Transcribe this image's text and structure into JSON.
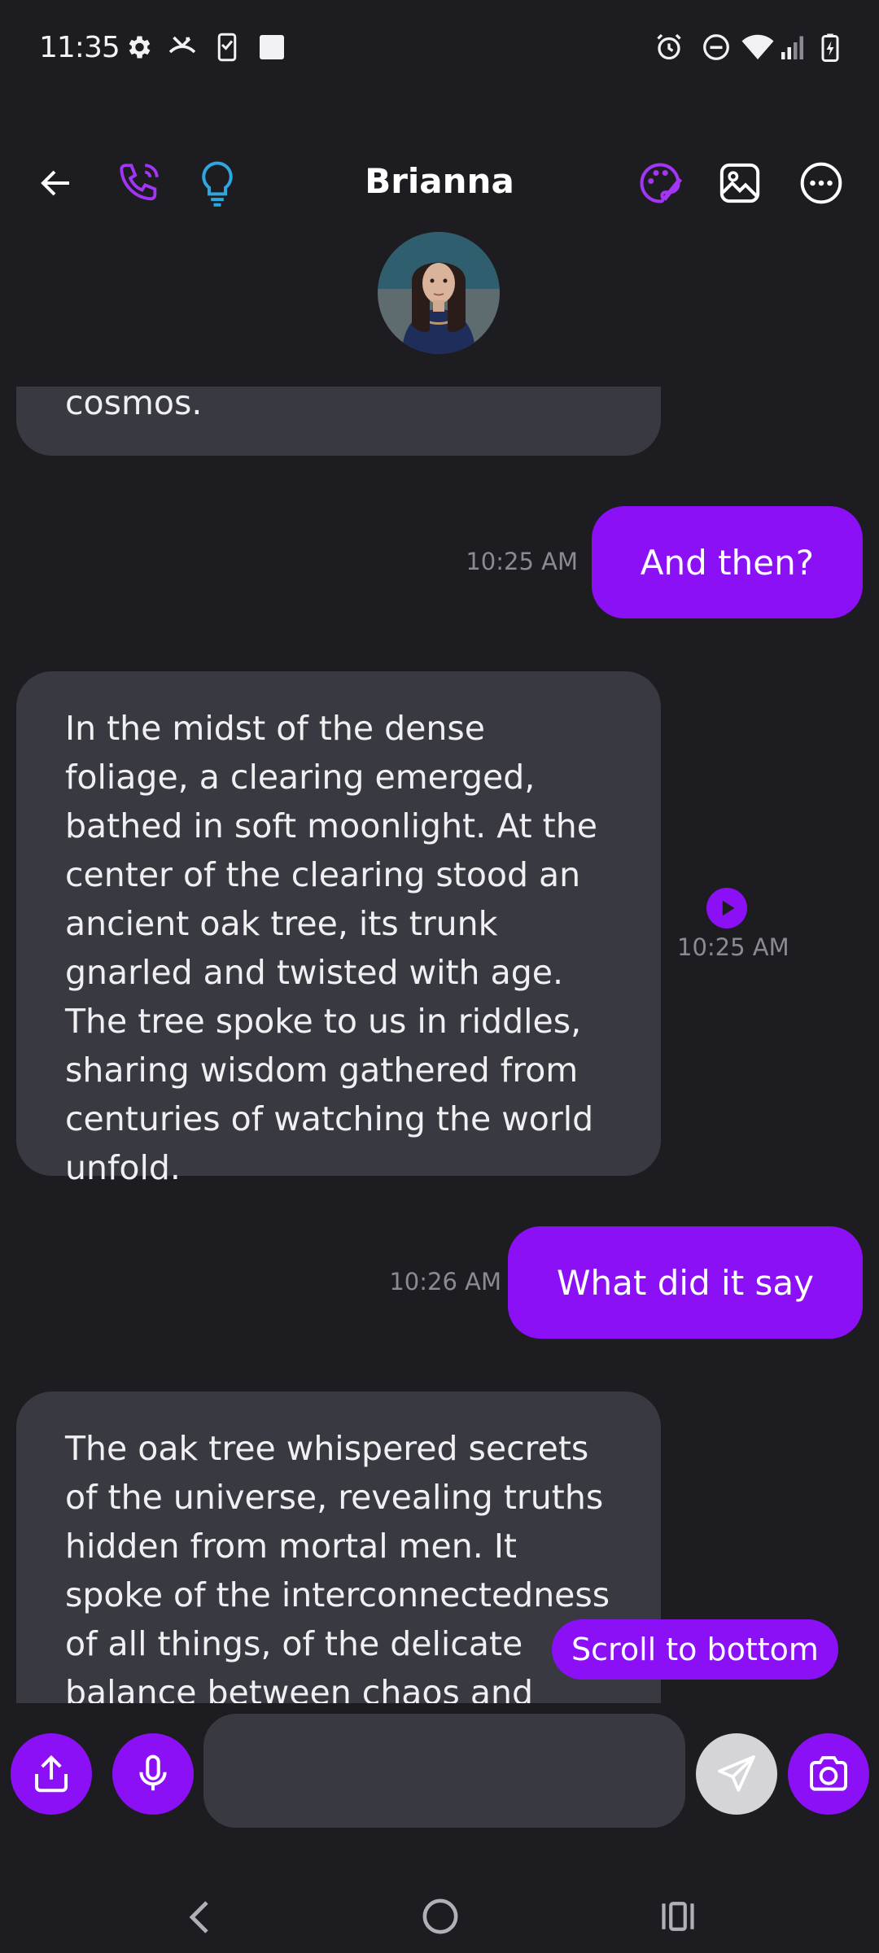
{
  "status_bar": {
    "time": "11:35",
    "left_icons": [
      "gear-icon",
      "missed-call-icon",
      "clipboard-check-icon",
      "square-icon"
    ],
    "right_icons": [
      "alarm-icon",
      "do-not-disturb-icon",
      "wifi-icon",
      "signal-icon",
      "battery-charging-icon"
    ]
  },
  "header": {
    "title": "Brianna",
    "left_icons": [
      "back-arrow-icon",
      "phone-icon",
      "lightbulb-icon"
    ],
    "right_icons": [
      "palette-icon",
      "image-icon",
      "more-options-icon"
    ]
  },
  "messages": [
    {
      "sender": "them",
      "text": "cosmos."
    },
    {
      "sender": "me",
      "text": "And then?",
      "time": "10:25 AM"
    },
    {
      "sender": "them",
      "text": "In the midst of the dense foliage, a clearing emerged, bathed in soft moonlight. At the center of the clearing stood an ancient oak tree, its trunk gnarled and twisted with age. The tree spoke to us in riddles, sharing wisdom gathered from centuries of watching the world unfold.",
      "time": "10:25 AM"
    },
    {
      "sender": "me",
      "text": "What did it say",
      "time": "10:26 AM"
    },
    {
      "sender": "them",
      "text": "The oak tree whispered secrets of the universe, revealing truths hidden from mortal men. It spoke of the interconnectedness of all things, of the delicate balance between chaos and"
    }
  ],
  "scroll_to_bottom": "Scroll to bottom",
  "composer": {
    "placeholder": "",
    "buttons": [
      "share-icon",
      "microphone-icon",
      "send-icon",
      "camera-icon"
    ]
  },
  "colors": {
    "background": "#1c1c21",
    "incoming_bubble": "#393a41",
    "accent": "#8b10f5",
    "phone_icon": "#a335f5",
    "lightbulb_icon": "#2ea7e0",
    "timestamp": "#8a8a92"
  }
}
